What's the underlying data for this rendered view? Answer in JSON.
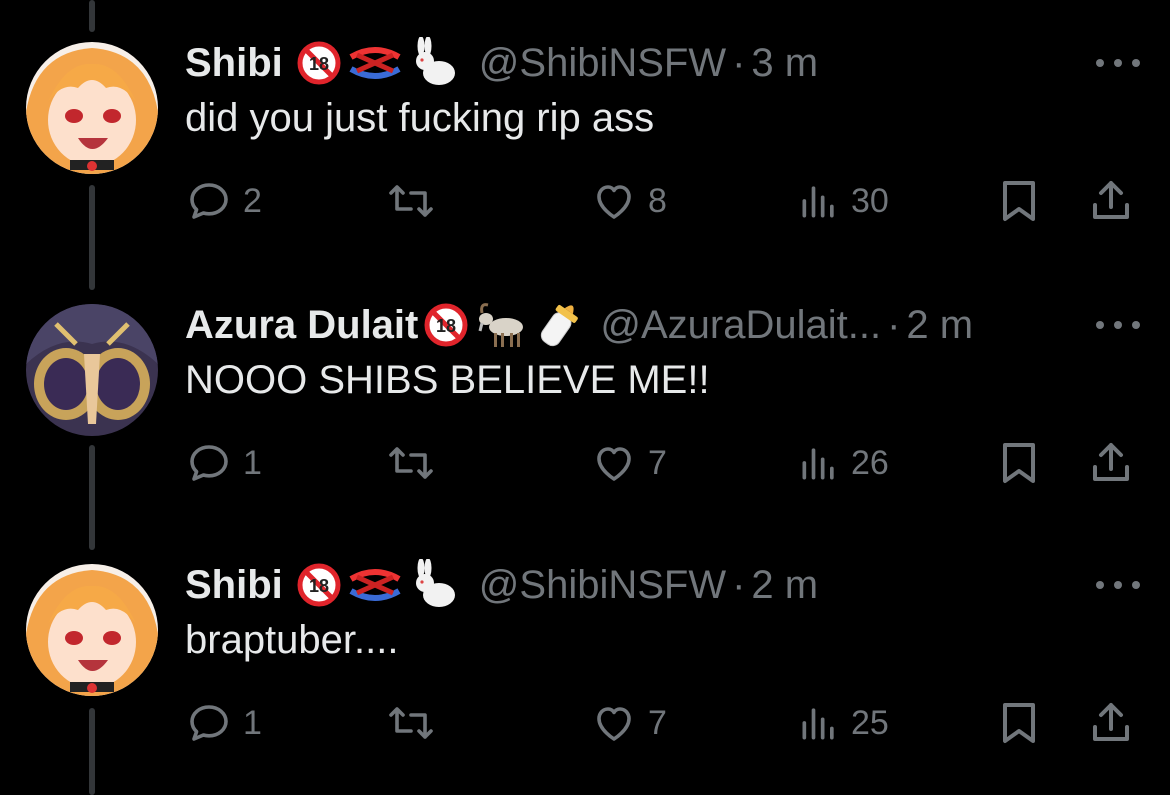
{
  "tweets": [
    {
      "name": "Shibi",
      "badges": [
        "🔞",
        "🪢",
        "🐇"
      ],
      "handle": "@ShibiNSFW",
      "separator": "·",
      "time": "3 m",
      "text": "did you just fucking rip ass",
      "replies": "2",
      "likes": "8",
      "views": "30",
      "avatar": "orange-haired-anime-girl"
    },
    {
      "name": "Azura Dulait",
      "badges": [
        "🔞",
        "🐐",
        "🍼"
      ],
      "handle": "@AzuraDulait...",
      "separator": "·",
      "time": "2 m",
      "text": "NOOO SHIBS BELIEVE ME!!",
      "replies": "1",
      "likes": "7",
      "views": "26",
      "avatar": "gold-armored-anime-figure"
    },
    {
      "name": "Shibi",
      "badges": [
        "🔞",
        "🪢",
        "🐇"
      ],
      "handle": "@ShibiNSFW",
      "separator": "·",
      "time": "2 m",
      "text": "braptuber....",
      "replies": "1",
      "likes": "7",
      "views": "25",
      "avatar": "orange-haired-anime-girl"
    }
  ],
  "theme": {
    "background": "#000000",
    "text": "#e7e9ea",
    "muted": "#71767b",
    "thread_line": "#333639"
  }
}
